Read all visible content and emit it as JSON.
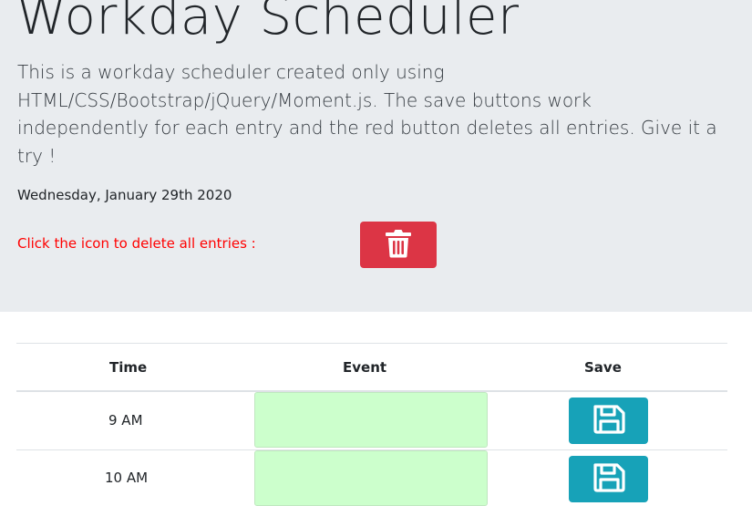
{
  "header": {
    "title": "Workday Scheduler",
    "description": "This is a workday scheduler created only using HTML/CSS/Bootstrap/jQuery/Moment.js. The save buttons work independently for each entry and the red button deletes all entries. Give it a try !",
    "current_date": "Wednesday, January 29th 2020",
    "delete_prompt": "Click the icon to delete all entries :",
    "delete_icon": "trash-icon"
  },
  "table": {
    "columns": [
      "Time",
      "Event",
      "Save"
    ],
    "rows": [
      {
        "time": "9 AM",
        "event": "",
        "save_icon": "floppy-disk-icon"
      },
      {
        "time": "10 AM",
        "event": "",
        "save_icon": "floppy-disk-icon"
      }
    ]
  },
  "colors": {
    "header_bg": "#e9ecef",
    "delete_button": "#dc3545",
    "save_button": "#17a2b8",
    "event_future": "#ccffcc",
    "delete_prompt_text": "#ff0000"
  }
}
